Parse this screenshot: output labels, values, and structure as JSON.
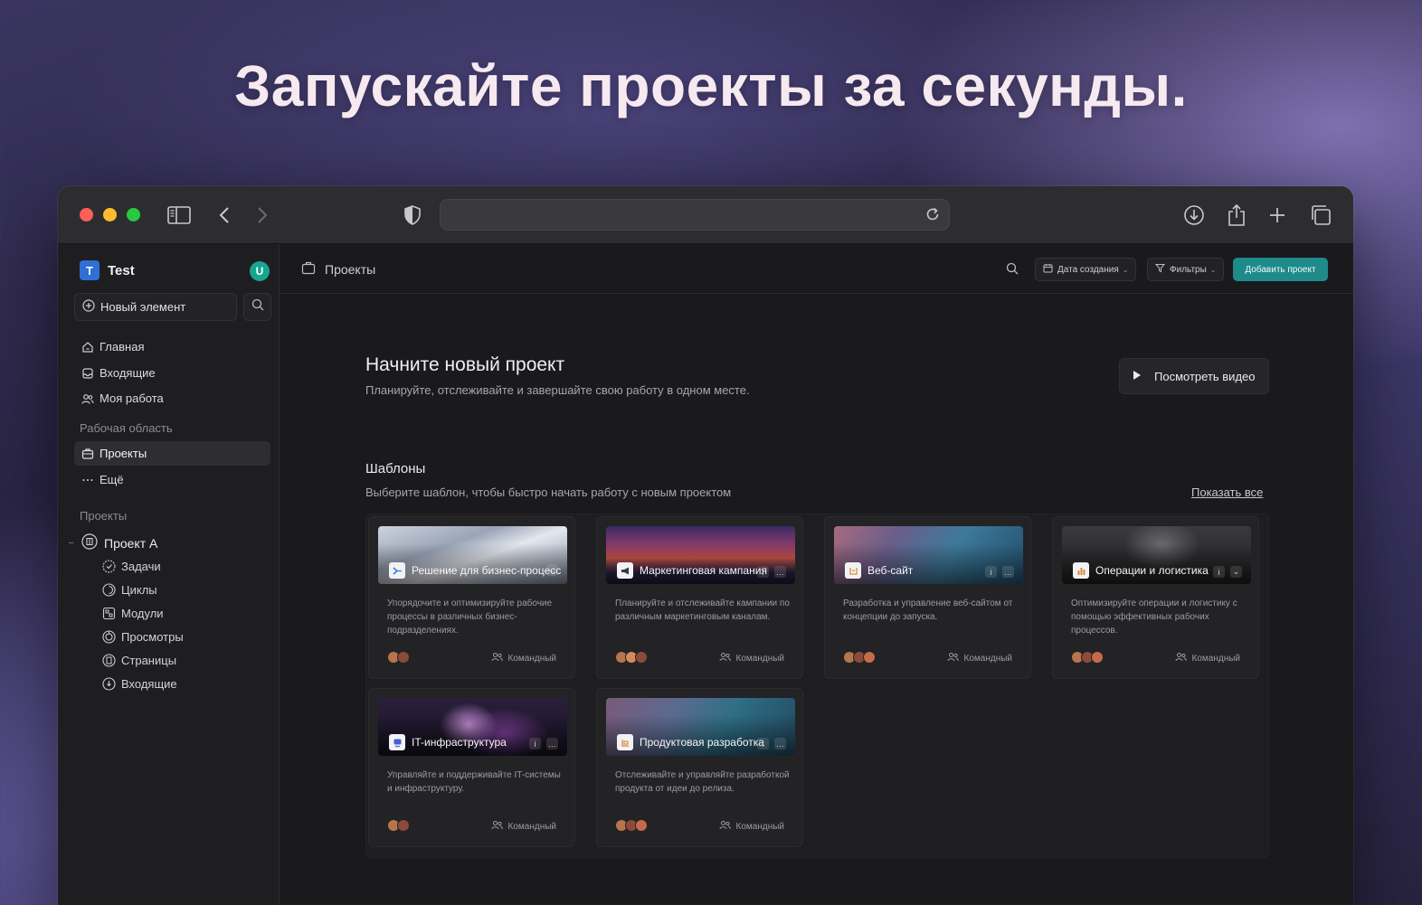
{
  "headline": "Запускайте проекты за секунды.",
  "sidebar": {
    "workspace_initial": "T",
    "workspace_name": "Test",
    "user_initial": "U",
    "new_item": "Новый элемент",
    "nav": [
      {
        "label": "Главная",
        "icon": "home-icon"
      },
      {
        "label": "Входящие",
        "icon": "inbox-icon"
      },
      {
        "label": "Моя работа",
        "icon": "users-icon"
      }
    ],
    "workspace_section": "Рабочая область",
    "workspace_items": [
      {
        "label": "Проекты",
        "icon": "briefcase-icon",
        "active": true
      },
      {
        "label": "Ещё",
        "icon": "more-icon"
      }
    ],
    "projects_section": "Проекты",
    "project_a": {
      "label": "Проект A",
      "children": [
        "Задачи",
        "Циклы",
        "Модули",
        "Просмотры",
        "Страницы",
        "Входящие"
      ]
    }
  },
  "header": {
    "breadcrumb": "Проекты",
    "sort_label": "Дата создания",
    "filter_label": "Фильтры",
    "add_label": "Добавить проект"
  },
  "hero": {
    "title": "Начните новый проект",
    "subtitle": "Планируйте, отслеживайте и завершайте свою работу в одном месте.",
    "video_label": "Посмотреть видео"
  },
  "templates": {
    "title": "Шаблоны",
    "subtitle": "Выберите шаблон, чтобы быстро начать работу с новым проектом",
    "show_all": "Показать все",
    "team_label": "Командный",
    "items": [
      {
        "name": "Решение для бизнес-процесс",
        "desc": "Упорядочите и оптимизируйте рабочие процессы в различных бизнес-подразделениях."
      },
      {
        "name": "Маркетинговая кампания",
        "desc": "Планируйте и отслеживайте кампании по различным маркетинговым каналам."
      },
      {
        "name": "Веб-сайт",
        "desc": "Разработка и управление веб-сайтом от концепции до запуска."
      },
      {
        "name": "Операции и логистика",
        "desc": "Оптимизируйте операции и логистику с помощью эффективных рабочих процессов."
      },
      {
        "name": "IT-инфраструктура",
        "desc": "Управляйте и поддерживайте IT-системы и инфраструктуру."
      },
      {
        "name": "Продуктовая разработка",
        "desc": "Отслеживайте и управляйте разработкой продукта от идеи до релиза."
      }
    ]
  },
  "colors": {
    "accent": "#1f8a8a",
    "workspace_logo": "#2f6fd6",
    "user_avatar": "#17a58f"
  }
}
